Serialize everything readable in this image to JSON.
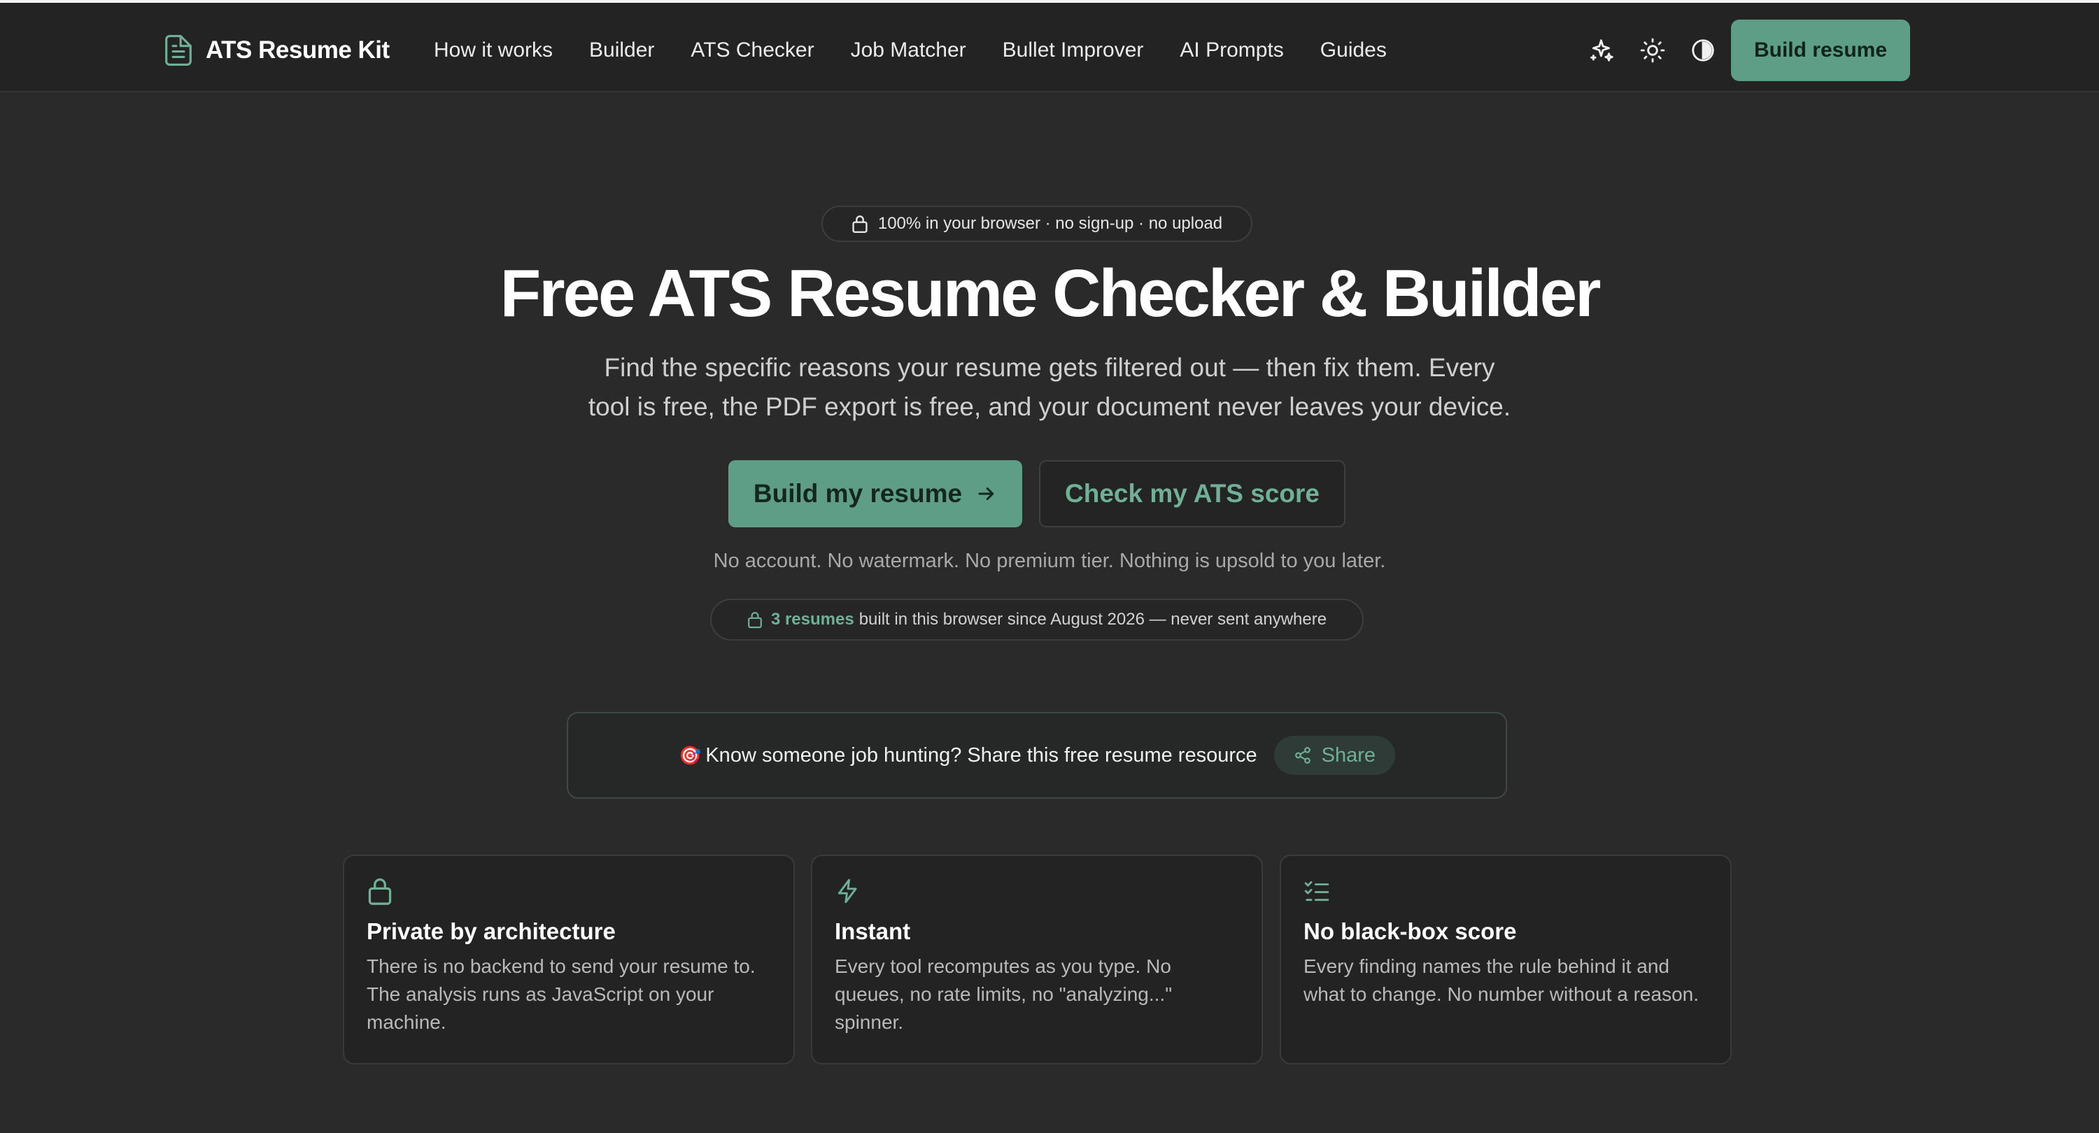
{
  "header": {
    "logo_text": "ATS Resume Kit",
    "nav": [
      "How it works",
      "Builder",
      "ATS Checker",
      "Job Matcher",
      "Bullet Improver",
      "AI Prompts",
      "Guides"
    ],
    "icons": [
      "sparkles-icon",
      "sun-icon",
      "contrast-icon"
    ],
    "cta": "Build resume"
  },
  "hero": {
    "badge": "100% in your browser · no sign-up · no upload",
    "title": "Free ATS Resume Checker & Builder",
    "subtitle_line1": "Find the specific reasons your resume gets filtered out — then fix them. Every",
    "subtitle_line2": "tool is free, the PDF export is free, and your document never leaves your device.",
    "primary_button": "Build my resume",
    "secondary_button": "Check my ATS score",
    "note": "No account. No watermark. No premium tier. Nothing is upsold to you later.",
    "count_strong": "3 resumes",
    "count_rest": "built in this browser since August 2026 — never sent anywhere"
  },
  "share": {
    "emoji": "🎯",
    "text": "Know someone job hunting? Share this free resume resource",
    "button": "Share"
  },
  "features": [
    {
      "icon": "lock-icon",
      "title": "Private by architecture",
      "body": "There is no backend to send your resume to. The analysis runs as JavaScript on your machine."
    },
    {
      "icon": "zap-icon",
      "title": "Instant",
      "body": "Every tool recomputes as you type. No queues, no rate limits, no \"analyzing...\" spinner."
    },
    {
      "icon": "list-checks-icon",
      "title": "No black-box score",
      "body": "Every finding names the rule behind it and what to change. No number without a reason."
    }
  ],
  "colors": {
    "accent": "#5e9e86",
    "accent_text": "#6fb097",
    "background": "#2a2a2b",
    "header_bg": "#232324"
  }
}
